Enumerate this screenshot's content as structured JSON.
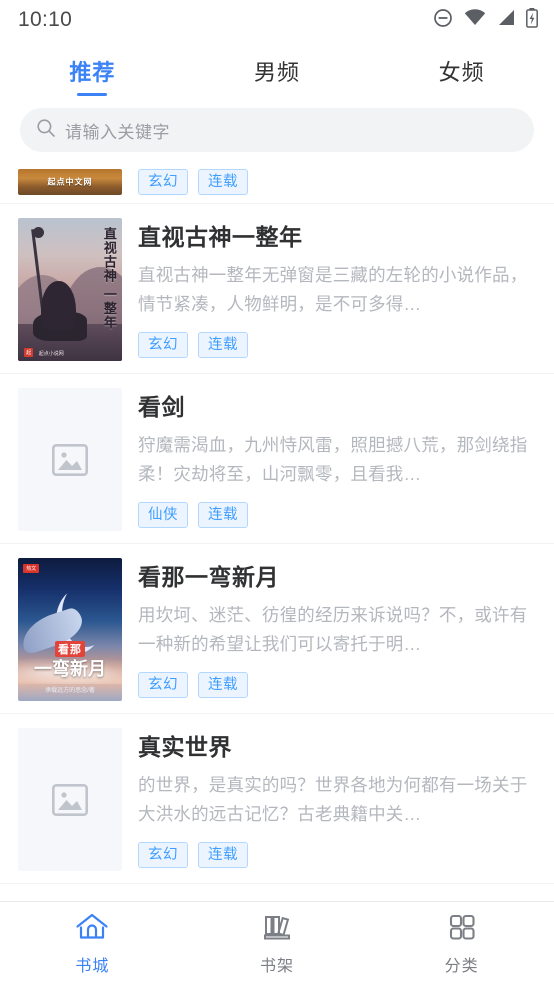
{
  "status_bar": {
    "time": "10:10",
    "icons": [
      "do-not-disturb-icon",
      "wifi-icon",
      "signal-icon",
      "battery-charging-icon"
    ]
  },
  "tabs": [
    {
      "label": "推荐",
      "active": true
    },
    {
      "label": "男频",
      "active": false
    },
    {
      "label": "女频",
      "active": false
    }
  ],
  "search": {
    "placeholder": "请输入关键字",
    "value": "",
    "icon": "search-icon"
  },
  "books": [
    {
      "title": "",
      "description": "",
      "tags": [
        "玄幻",
        "连载"
      ],
      "cover": "image",
      "cover_text": "起点中文网",
      "partial": true
    },
    {
      "title": "直视古神一整年",
      "description": "直视古神一整年无弹窗是三藏的左轮的小说作品，情节紧凑，人物鲜明，是不可多得…",
      "tags": [
        "玄幻",
        "连载"
      ],
      "cover": "image",
      "cover_text": "直视古神 一整年",
      "partial": false
    },
    {
      "title": "看剑",
      "description": "狩魔需渴血，九州恃风雷，照胆撼八荒，那剑绕指柔！灾劫将至，山河飘零，且看我…",
      "tags": [
        "仙侠",
        "连载"
      ],
      "cover": "placeholder",
      "cover_text": "",
      "partial": false
    },
    {
      "title": "看那一弯新月",
      "description": "用坎坷、迷茫、彷徨的经历来诉说吗？不，或许有一种新的希望让我们可以寄托于明…",
      "tags": [
        "玄幻",
        "连载"
      ],
      "cover": "image",
      "cover_text": "看那一弯新月",
      "partial": false
    },
    {
      "title": "真实世界",
      "description": "的世界，是真实的吗？世界各地为何都有一场关于大洪水的远古记忆？古老典籍中关…",
      "tags": [
        "玄幻",
        "连载"
      ],
      "cover": "placeholder",
      "cover_text": "",
      "partial": false
    }
  ],
  "bottom_nav": [
    {
      "label": "书城",
      "icon": "home-icon",
      "active": true
    },
    {
      "label": "书架",
      "icon": "bookshelf-icon",
      "active": false
    },
    {
      "label": "分类",
      "icon": "grid-icon",
      "active": false
    }
  ],
  "colors": {
    "accent": "#3b82f6",
    "tag_text": "#409eff",
    "tag_bg": "#ecf5ff",
    "tag_border": "#b3d8ff",
    "title_text": "#303133",
    "desc_text": "#b4b7bd",
    "nav_inactive": "#7c7f85",
    "search_bg": "#f2f3f5",
    "placeholder_bg": "#f5f7fa"
  }
}
